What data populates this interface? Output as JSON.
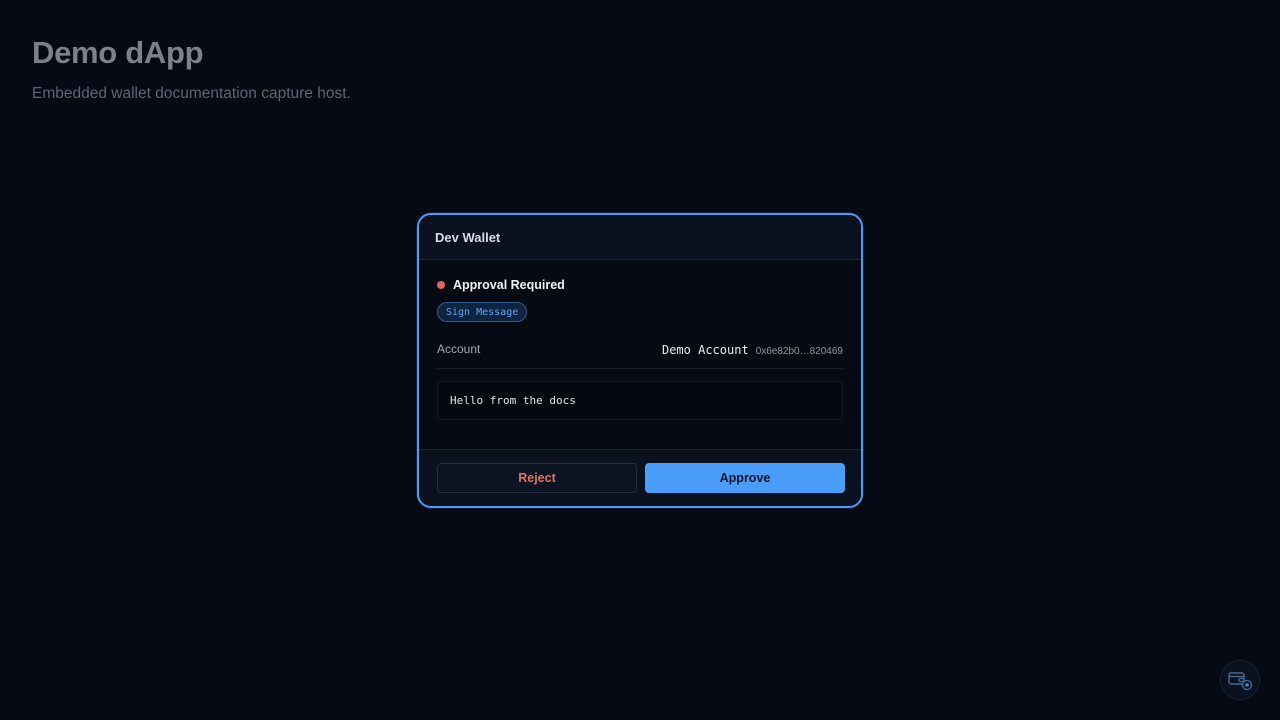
{
  "host": {
    "title": "Demo dApp",
    "subtitle": "Embedded wallet documentation capture host."
  },
  "wallet": {
    "title": "Dev Wallet",
    "status": {
      "text": "Approval Required",
      "color": "#e0665a"
    },
    "method_badge": "Sign Message",
    "account": {
      "label": "Account",
      "name": "Demo Account",
      "address": "0x6e82b0…820469"
    },
    "message": "Hello from the docs",
    "buttons": {
      "reject": "Reject",
      "approve": "Approve"
    },
    "colors": {
      "accent": "#4a9df8",
      "reject_text": "#e0765f"
    }
  },
  "launcher": {
    "icon": "wallet-settings-icon"
  }
}
